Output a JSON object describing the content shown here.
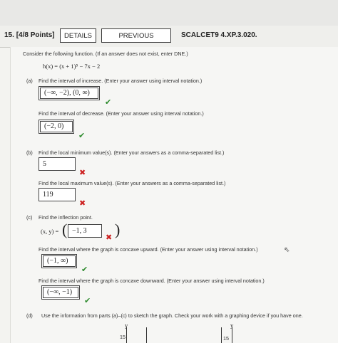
{
  "header": {
    "question_number": "15.",
    "points": "[4/8 Points]",
    "details_label": "DETAILS",
    "previous_answers_label": "PREVIOUS ANSWERS",
    "problem_code": "SCALCET9 4.XP.3.020."
  },
  "intro": {
    "instruction": "Consider the following function. (If an answer does not exist, enter DNE.)",
    "function": "h(x) = (x + 1)⁵ − 7x − 2"
  },
  "part_a": {
    "label": "(a)",
    "prompt_increase": "Find the interval of increase. (Enter your answer using interval notation.)",
    "answer_increase": "(−∞, −2), (0, ∞)",
    "prompt_decrease": "Find the interval of decrease. (Enter your answer using interval notation.)",
    "answer_decrease": "(−2, 0)"
  },
  "part_b": {
    "label": "(b)",
    "prompt_min": "Find the local minimum value(s). (Enter your answers as a comma-separated list.)",
    "answer_min": "5",
    "prompt_max": "Find the local maximum value(s). (Enter your answers as a comma-separated list.)",
    "answer_max": "119"
  },
  "part_c": {
    "label": "(c)",
    "prompt_inflection": "Find the inflection point.",
    "xy_label": "(x, y) =",
    "answer_inflection": "−1, 3",
    "prompt_up": "Find the interval where the graph is concave upward. (Enter your answer using interval notation.)",
    "answer_up": "(−1, ∞)",
    "prompt_down": "Find the interval where the graph is concave downward. (Enter your answer using interval notation.)",
    "answer_down": "(−∞, −1)"
  },
  "part_d": {
    "label": "(d)",
    "prompt": "Use the information from parts (a)–(c) to sketch the graph. Check your work with a graphing device if you have one.",
    "graph_y_label_1": "y",
    "graph_tick_1": "15",
    "graph_y_label_2": "y",
    "graph_tick_2": "15"
  },
  "marks": {
    "check": "✔",
    "cross": "✖"
  },
  "colors": {
    "correct": "#2e8b2e",
    "incorrect": "#cc2020"
  }
}
